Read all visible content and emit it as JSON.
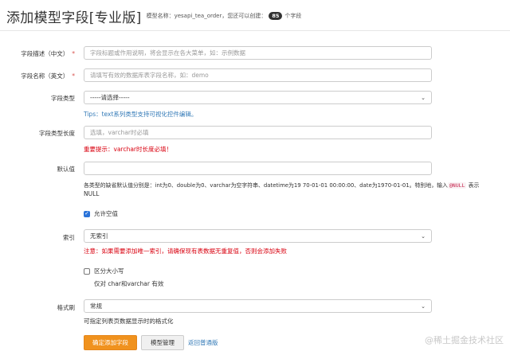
{
  "header": {
    "title": "添加模型字段[专业版]",
    "model_label": "模型名称：yesapi_tea_order，您还可以创建：",
    "remaining_count": "85",
    "count_suffix": "个字段"
  },
  "fields": {
    "desc": {
      "label": "字段描述（中文）",
      "required_mark": "*",
      "placeholder": "字段标题或作用说明，将会显示在各大菜单，如：示例数据"
    },
    "name": {
      "label": "字段名称（英文）",
      "required_mark": "*",
      "placeholder": "请填写有效的数据库表字段名称，如：demo"
    },
    "type": {
      "label": "字段类型",
      "selected": "-----请选择-----",
      "tip": "Tips：text系列类型支持可视化控件编辑。"
    },
    "length": {
      "label": "字段类型长度",
      "placeholder": "选填，varchar时必填",
      "warning": "重要提示：varchar时长度必填！"
    },
    "default": {
      "label": "默认值",
      "value": "",
      "help_line1": "各类型的缺省默认值分别是：int为0、double为0、varchar为空字符串、datetime为19 70-01-01 00:00:00、date为1970-01-01。特别地，输入",
      "null_code": "@NULL",
      "help_after_code": "表示",
      "help_line2": "NULL"
    },
    "allow_null": {
      "label": "允许空值",
      "checked": true
    },
    "index": {
      "label": "索引",
      "selected": "无索引",
      "warning": "注意：如果需要添加唯一索引，请确保现有表数据无重复值，否则会添加失败"
    },
    "case_sensitive": {
      "label": "区分大小写",
      "checked": false,
      "help": "仅对 char和varchar 有效"
    },
    "format": {
      "label": "格式刷",
      "selected": "常规",
      "help": "可指定列表页数据显示时的格式化"
    }
  },
  "actions": {
    "submit": "确定添加字段",
    "manage": "模型管理",
    "back": "返回普通版"
  },
  "watermark": "@稀土掘金技术社区",
  "colors": {
    "primary": "#f0921e",
    "link": "#337ab7",
    "danger": "#d9000f",
    "checkbox": "#2a73d9"
  }
}
